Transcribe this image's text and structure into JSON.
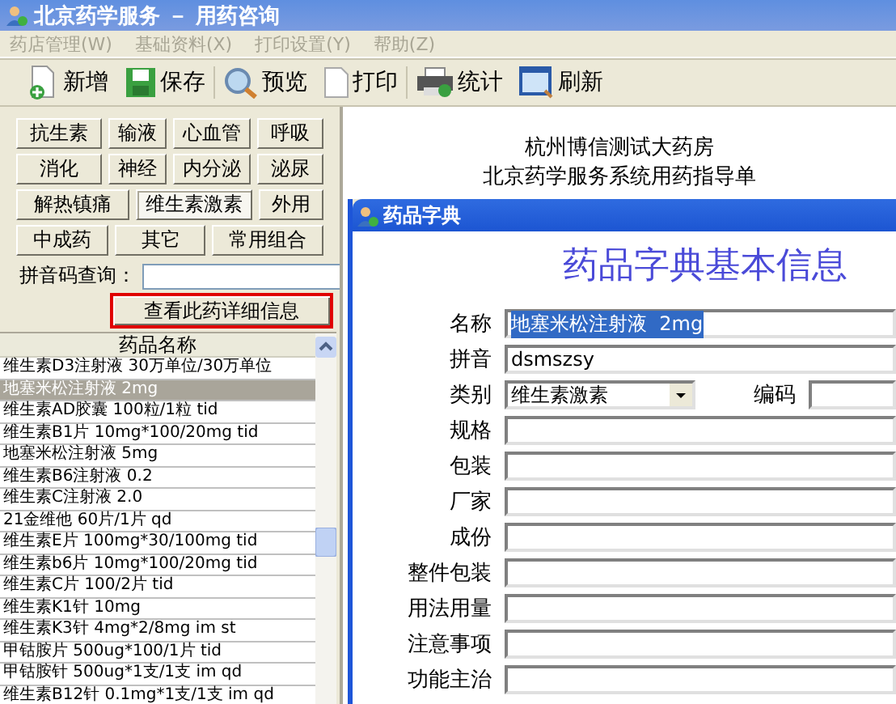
{
  "window": {
    "title": "北京药学服务 － 用药咨询"
  },
  "menu": [
    {
      "label": "药店管理(W)",
      "disabled": true
    },
    {
      "label": "基础资料(X)",
      "disabled": true
    },
    {
      "label": "打印设置(Y)",
      "disabled": true
    },
    {
      "label": "帮助(Z)",
      "disabled": true
    }
  ],
  "toolbar": [
    {
      "label": "新增",
      "kind": "new"
    },
    {
      "label": "保存",
      "kind": "save"
    },
    {
      "label": "预览",
      "kind": "preview"
    },
    {
      "label": "打印",
      "kind": "print"
    },
    {
      "label": "统计",
      "kind": "stats"
    },
    {
      "label": "刷新",
      "kind": "refresh"
    }
  ],
  "categories": [
    [
      {
        "label": "抗生素",
        "selected": false
      },
      {
        "label": "输液",
        "selected": false
      },
      {
        "label": "心血管",
        "selected": false
      },
      {
        "label": "呼吸",
        "selected": false
      }
    ],
    [
      {
        "label": "消化",
        "selected": false
      },
      {
        "label": "神经",
        "selected": false
      },
      {
        "label": "内分泌",
        "selected": false
      },
      {
        "label": "泌尿",
        "selected": false
      }
    ],
    [
      {
        "label": "解热镇痛",
        "selected": false
      },
      {
        "label": "维生素激素",
        "selected": true
      },
      {
        "label": "外用",
        "selected": false
      }
    ],
    [
      {
        "label": "中成药",
        "selected": false
      },
      {
        "label": "其它",
        "selected": false
      },
      {
        "label": "常用组合",
        "selected": false
      }
    ]
  ],
  "pinyin_search": {
    "label": "拼音码查询："
  },
  "detail_button": {
    "label": "查看此药详细信息",
    "highlighted": true
  },
  "drug_list": {
    "header": "药品名称",
    "rows": [
      {
        "text": "维生素D3注射液  30万单位/30万单位",
        "selected": false
      },
      {
        "text": "地塞米松注射液  2mg",
        "selected": true
      },
      {
        "text": "维生素AD胶囊  100粒/1粒   tid",
        "selected": false
      },
      {
        "text": "维生素B1片  10mg*100/20mg  tid",
        "selected": false
      },
      {
        "text": "地塞米松注射液  5mg",
        "selected": false
      },
      {
        "text": "维生素B6注射液  0.2",
        "selected": false
      },
      {
        "text": "维生素C注射液  2.0",
        "selected": false
      },
      {
        "text": "21金维他  60片/1片 qd",
        "selected": false
      },
      {
        "text": "维生素E片  100mg*30/100mg tid",
        "selected": false
      },
      {
        "text": "维生素b6片  10mg*100/20mg tid",
        "selected": false
      },
      {
        "text": "维生素C片  100/2片 tid",
        "selected": false
      },
      {
        "text": "维生素K1针 10mg",
        "selected": false
      },
      {
        "text": "维生素K3针 4mg*2/8mg im st",
        "selected": false
      },
      {
        "text": "甲钴胺片 500ug*100/1片 tid",
        "selected": false
      },
      {
        "text": "甲钴胺针 500ug*1支/1支 im qd",
        "selected": false
      },
      {
        "text": "维生素B12针 0.1mg*1支/1支 im qd",
        "selected": false
      }
    ]
  },
  "report": {
    "lines": [
      "杭州博信测试大药房",
      "北京药学服务系统用药指导单"
    ]
  },
  "dialog": {
    "title": "药品字典",
    "heading": "药品字典基本信息",
    "fields": [
      {
        "label": "名称",
        "kind": "text",
        "value": "地塞米松注射液  2mg",
        "highlighted": true
      },
      {
        "label": "拼音",
        "kind": "text",
        "value": "dsmszsy",
        "highlighted": false
      },
      {
        "label": "类别",
        "kind": "select",
        "value": "维生素激素",
        "side_label": "编码"
      },
      {
        "label": "规格",
        "kind": "text"
      },
      {
        "label": "包装",
        "kind": "text"
      },
      {
        "label": "厂家",
        "kind": "text"
      },
      {
        "label": "成份",
        "kind": "text"
      },
      {
        "label": "整件包装",
        "kind": "text"
      },
      {
        "label": "用法用量",
        "kind": "text"
      },
      {
        "label": "注意事项",
        "kind": "text"
      },
      {
        "label": "功能主治",
        "kind": "text"
      }
    ]
  }
}
